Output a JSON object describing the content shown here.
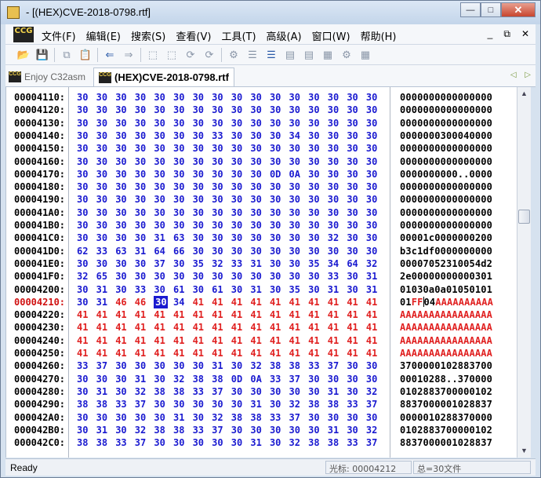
{
  "window": {
    "title": "- [(HEX)CVE-2018-0798.rtf]",
    "minimize": "—",
    "maximize": "□",
    "close": "✕"
  },
  "menubar": {
    "logo": "CCG",
    "items": [
      "文件(F)",
      "编辑(E)",
      "搜索(S)",
      "查看(V)",
      "工具(T)",
      "高级(A)",
      "窗口(W)",
      "帮助(H)"
    ],
    "mdi_controls": [
      "_",
      "⧉",
      "✕"
    ]
  },
  "toolbar": {
    "icons": [
      "open-folder-icon",
      "save-icon",
      "copy-icon",
      "paste-icon",
      "back-arrow-icon",
      "forward-arrow-icon",
      "tool-icon-1",
      "tool-icon-2",
      "tool-icon-3",
      "tool-icon-4",
      "tool-icon-5",
      "tool-icon-6",
      "tool-icon-7",
      "tool-icon-8",
      "tool-icon-9",
      "tool-icon-10",
      "tool-icon-11",
      "tool-icon-12"
    ]
  },
  "tabs": [
    {
      "label": "Enjoy C32asm",
      "active": false
    },
    {
      "label": "(HEX)CVE-2018-0798.rtf",
      "active": true
    }
  ],
  "hex": {
    "rows": [
      {
        "addr": "00004110:",
        "bytes": [
          "30",
          "30",
          "30",
          "30",
          "30",
          "30",
          "30",
          "30",
          "30",
          "30",
          "30",
          "30",
          "30",
          "30",
          "30",
          "30"
        ],
        "ascii": "0000000000000000"
      },
      {
        "addr": "00004120:",
        "bytes": [
          "30",
          "30",
          "30",
          "30",
          "30",
          "30",
          "30",
          "30",
          "30",
          "30",
          "30",
          "30",
          "30",
          "30",
          "30",
          "30"
        ],
        "ascii": "0000000000000000"
      },
      {
        "addr": "00004130:",
        "bytes": [
          "30",
          "30",
          "30",
          "30",
          "30",
          "30",
          "30",
          "30",
          "30",
          "30",
          "30",
          "30",
          "30",
          "30",
          "30",
          "30"
        ],
        "ascii": "0000000000000000"
      },
      {
        "addr": "00004140:",
        "bytes": [
          "30",
          "30",
          "30",
          "30",
          "30",
          "30",
          "30",
          "33",
          "30",
          "30",
          "30",
          "34",
          "30",
          "30",
          "30",
          "30"
        ],
        "ascii": "0000000300040000"
      },
      {
        "addr": "00004150:",
        "bytes": [
          "30",
          "30",
          "30",
          "30",
          "30",
          "30",
          "30",
          "30",
          "30",
          "30",
          "30",
          "30",
          "30",
          "30",
          "30",
          "30"
        ],
        "ascii": "0000000000000000"
      },
      {
        "addr": "00004160:",
        "bytes": [
          "30",
          "30",
          "30",
          "30",
          "30",
          "30",
          "30",
          "30",
          "30",
          "30",
          "30",
          "30",
          "30",
          "30",
          "30",
          "30"
        ],
        "ascii": "0000000000000000"
      },
      {
        "addr": "00004170:",
        "bytes": [
          "30",
          "30",
          "30",
          "30",
          "30",
          "30",
          "30",
          "30",
          "30",
          "30",
          "0D",
          "0A",
          "30",
          "30",
          "30",
          "30"
        ],
        "ascii": "0000000000..0000"
      },
      {
        "addr": "00004180:",
        "bytes": [
          "30",
          "30",
          "30",
          "30",
          "30",
          "30",
          "30",
          "30",
          "30",
          "30",
          "30",
          "30",
          "30",
          "30",
          "30",
          "30"
        ],
        "ascii": "0000000000000000"
      },
      {
        "addr": "00004190:",
        "bytes": [
          "30",
          "30",
          "30",
          "30",
          "30",
          "30",
          "30",
          "30",
          "30",
          "30",
          "30",
          "30",
          "30",
          "30",
          "30",
          "30"
        ],
        "ascii": "0000000000000000"
      },
      {
        "addr": "000041A0:",
        "bytes": [
          "30",
          "30",
          "30",
          "30",
          "30",
          "30",
          "30",
          "30",
          "30",
          "30",
          "30",
          "30",
          "30",
          "30",
          "30",
          "30"
        ],
        "ascii": "0000000000000000"
      },
      {
        "addr": "000041B0:",
        "bytes": [
          "30",
          "30",
          "30",
          "30",
          "30",
          "30",
          "30",
          "30",
          "30",
          "30",
          "30",
          "30",
          "30",
          "30",
          "30",
          "30"
        ],
        "ascii": "0000000000000000"
      },
      {
        "addr": "000041C0:",
        "bytes": [
          "30",
          "30",
          "30",
          "30",
          "31",
          "63",
          "30",
          "30",
          "30",
          "30",
          "30",
          "30",
          "30",
          "32",
          "30",
          "30"
        ],
        "ascii": "00001c0000000200"
      },
      {
        "addr": "000041D0:",
        "bytes": [
          "62",
          "33",
          "63",
          "31",
          "64",
          "66",
          "30",
          "30",
          "30",
          "30",
          "30",
          "30",
          "30",
          "30",
          "30",
          "30"
        ],
        "ascii": "b3c1df0000000000"
      },
      {
        "addr": "000041E0:",
        "bytes": [
          "30",
          "30",
          "30",
          "30",
          "37",
          "30",
          "35",
          "32",
          "33",
          "31",
          "30",
          "30",
          "35",
          "34",
          "64",
          "32"
        ],
        "ascii": "00007052310054d2"
      },
      {
        "addr": "000041F0:",
        "bytes": [
          "32",
          "65",
          "30",
          "30",
          "30",
          "30",
          "30",
          "30",
          "30",
          "30",
          "30",
          "30",
          "30",
          "33",
          "30",
          "31"
        ],
        "ascii": "2e00000000000301"
      },
      {
        "addr": "00004200:",
        "bytes": [
          "30",
          "31",
          "30",
          "33",
          "30",
          "61",
          "30",
          "61",
          "30",
          "31",
          "30",
          "35",
          "30",
          "31",
          "30",
          "31"
        ],
        "ascii": "01030a0a01050101"
      },
      {
        "addr": "00004210:",
        "bytes": [
          "30",
          "31",
          "46",
          "46",
          "30",
          "34",
          "41",
          "41",
          "41",
          "41",
          "41",
          "41",
          "41",
          "41",
          "41",
          "41"
        ],
        "ascii_pre": "01",
        "ascii_red": "FF",
        "ascii_post": "04",
        "ascii_tail": "AAAAAAAAAA"
      },
      {
        "addr": "00004220:",
        "bytes": [
          "41",
          "41",
          "41",
          "41",
          "41",
          "41",
          "41",
          "41",
          "41",
          "41",
          "41",
          "41",
          "41",
          "41",
          "41",
          "41"
        ],
        "ascii": "AAAAAAAAAAAAAAAA"
      },
      {
        "addr": "00004230:",
        "bytes": [
          "41",
          "41",
          "41",
          "41",
          "41",
          "41",
          "41",
          "41",
          "41",
          "41",
          "41",
          "41",
          "41",
          "41",
          "41",
          "41"
        ],
        "ascii": "AAAAAAAAAAAAAAAA"
      },
      {
        "addr": "00004240:",
        "bytes": [
          "41",
          "41",
          "41",
          "41",
          "41",
          "41",
          "41",
          "41",
          "41",
          "41",
          "41",
          "41",
          "41",
          "41",
          "41",
          "41"
        ],
        "ascii": "AAAAAAAAAAAAAAAA"
      },
      {
        "addr": "00004250:",
        "bytes": [
          "41",
          "41",
          "41",
          "41",
          "41",
          "41",
          "41",
          "41",
          "41",
          "41",
          "41",
          "41",
          "41",
          "41",
          "41",
          "41"
        ],
        "ascii": "AAAAAAAAAAAAAAAA"
      },
      {
        "addr": "00004260:",
        "bytes": [
          "33",
          "37",
          "30",
          "30",
          "30",
          "30",
          "30",
          "31",
          "30",
          "32",
          "38",
          "38",
          "33",
          "37",
          "30",
          "30"
        ],
        "ascii": "3700000102883700"
      },
      {
        "addr": "00004270:",
        "bytes": [
          "30",
          "30",
          "30",
          "31",
          "30",
          "32",
          "38",
          "38",
          "0D",
          "0A",
          "33",
          "37",
          "30",
          "30",
          "30",
          "30"
        ],
        "ascii": "00010288..370000"
      },
      {
        "addr": "00004280:",
        "bytes": [
          "30",
          "31",
          "30",
          "32",
          "38",
          "38",
          "33",
          "37",
          "30",
          "30",
          "30",
          "30",
          "30",
          "31",
          "30",
          "32"
        ],
        "ascii": "0102883700000102"
      },
      {
        "addr": "00004290:",
        "bytes": [
          "38",
          "38",
          "33",
          "37",
          "30",
          "30",
          "30",
          "30",
          "30",
          "31",
          "30",
          "32",
          "38",
          "38",
          "33",
          "37"
        ],
        "ascii": "8837000001028837"
      },
      {
        "addr": "000042A0:",
        "bytes": [
          "30",
          "30",
          "30",
          "30",
          "30",
          "31",
          "30",
          "32",
          "38",
          "38",
          "33",
          "37",
          "30",
          "30",
          "30",
          "30"
        ],
        "ascii": "0000010288370000"
      },
      {
        "addr": "000042B0:",
        "bytes": [
          "30",
          "31",
          "30",
          "32",
          "38",
          "38",
          "33",
          "37",
          "30",
          "30",
          "30",
          "30",
          "30",
          "31",
          "30",
          "32"
        ],
        "ascii": "0102883700000102"
      },
      {
        "addr": "000042C0:",
        "bytes": [
          "38",
          "38",
          "33",
          "37",
          "30",
          "30",
          "30",
          "30",
          "30",
          "31",
          "30",
          "32",
          "38",
          "38",
          "33",
          "37"
        ],
        "ascii": "8837000001028837"
      }
    ],
    "highlight_row": 16,
    "selected_byte": {
      "row": 16,
      "col": 4
    }
  },
  "status": {
    "ready": "Ready",
    "cursor": "光标: 00004212",
    "lines": "总=30文件"
  },
  "colors": {
    "bytes": "#1a1ad0",
    "marked": "#e02020",
    "selection": "#1a1ad0"
  }
}
